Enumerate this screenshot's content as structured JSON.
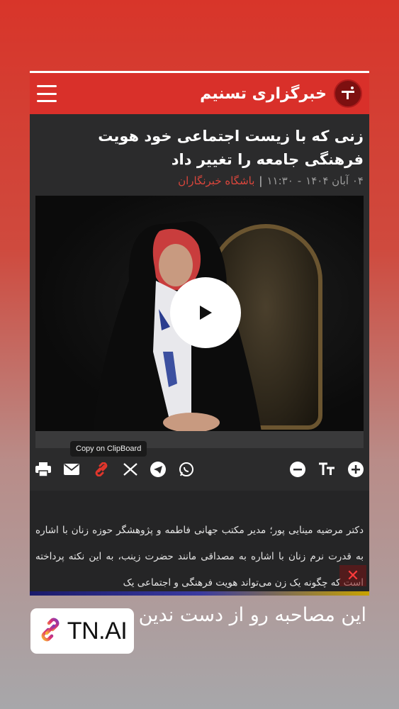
{
  "header": {
    "brand_name": "خبرگزاری تسنیم",
    "logo_icon": "tasnim-logo-icon",
    "menu_icon": "hamburger-menu-icon",
    "background": "#d9302a"
  },
  "article": {
    "title": "زنی که با زیست اجتماعی خود هویت فرهنگی جامعه را تغییر داد",
    "date": "۰۴ آبان ۱۴۰۴",
    "time": "۱۱:۳۰",
    "separator": "|",
    "dash": "-",
    "source": "باشگاه خبرنگاران",
    "body": "دکتر مرضیه مینایی پور؛ مدیر مکتب جهانی فاطمه و پژوهشگر حوزه زنان با اشاره به قدرت نرم زنان با اشاره به مصداقی مانند حضرت زینب، به این نکته پرداخته است که چگونه یک زن می‌تواند هویت فرهنگی و اجتماعی یک"
  },
  "video": {
    "play_icon": "play-icon"
  },
  "tooltip": "Copy on ClipBoard",
  "toolbar": {
    "left_icons": [
      "print-icon",
      "email-icon",
      "link-icon",
      "x-twitter-icon",
      "telegram-icon",
      "whatsapp-icon"
    ],
    "right_icons": [
      "zoom-out-icon",
      "text-size-icon",
      "zoom-in-icon"
    ],
    "accent_link": "#e0362c"
  },
  "close_label": "✕",
  "story": {
    "caption": "این مصاحبه رو از دست ندین",
    "badge_label": "TN.AI",
    "badge_icon": "link-icon"
  }
}
